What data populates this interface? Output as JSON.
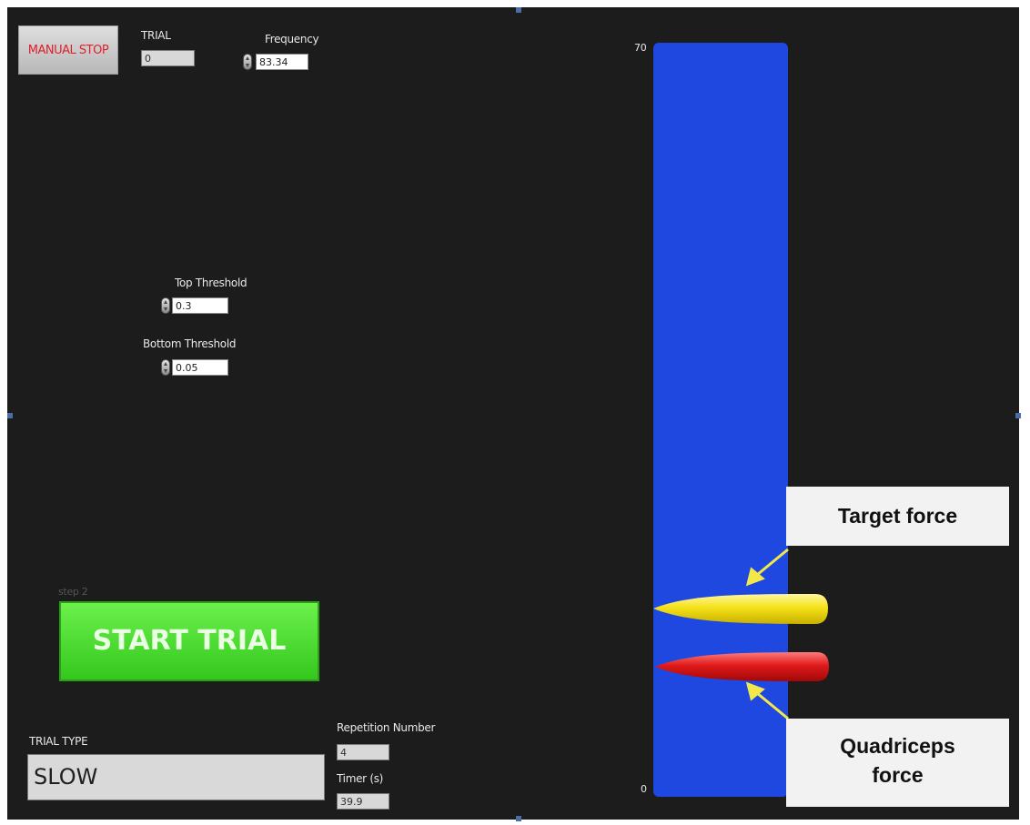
{
  "controls": {
    "manual_stop_label": "MANUAL STOP",
    "trial_label": "TRIAL",
    "trial_value": "0",
    "frequency_label": "Frequency",
    "frequency_value": "83.34",
    "top_threshold_label": "Top Threshold",
    "top_threshold_value": "0.3",
    "bottom_threshold_label": "Bottom Threshold",
    "bottom_threshold_value": "0.05",
    "step_label": "step 2",
    "start_trial_label": "START TRIAL",
    "trial_type_label": "TRIAL TYPE",
    "trial_type_value": "SLOW",
    "repetition_label": "Repetition Number",
    "repetition_value": "4",
    "timer_label": "Timer (s)",
    "timer_value": "39.9"
  },
  "gauge": {
    "scale_max": "70",
    "scale_min": "0",
    "bar_color": "#1e48e0",
    "target_color": "#f5e21a",
    "quadriceps_color": "#e01a1a"
  },
  "annotations": {
    "target_label": "Target force",
    "quadriceps_label": "Quadriceps force",
    "arrow_color": "#f2e84a"
  }
}
